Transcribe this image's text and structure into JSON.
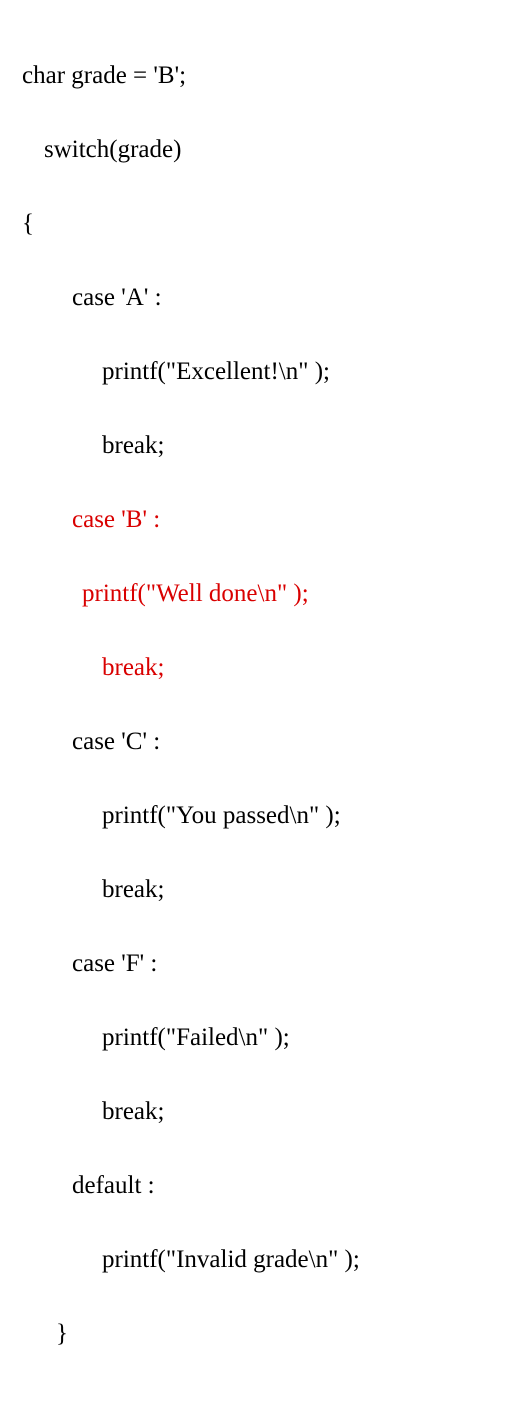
{
  "code": {
    "line1": "char grade = 'B';",
    "line2": "switch(grade)",
    "line3": "{",
    "line4": "case 'A' :",
    "line5": "printf(\"Excellent!\\n\" );",
    "line6": "break;",
    "line7": "case 'B' :",
    "line8": "printf(\"Well done\\n\" );",
    "line9": "break;",
    "line10": "case 'C' :",
    "line11": "printf(\"You passed\\n\" );",
    "line12": "break;",
    "line13": "case 'F' :",
    "line14": "printf(\"Failed\\n\" );",
    "line15": "break;",
    "line16": "default :",
    "line17": "printf(\"Invalid grade\\n\" );",
    "line18": "}"
  }
}
